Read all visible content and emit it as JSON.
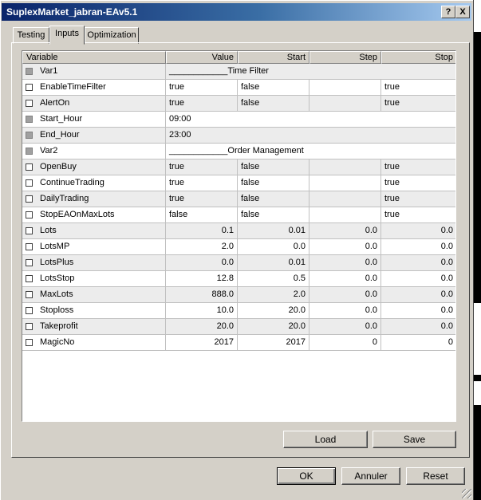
{
  "window": {
    "title": "SuplexMarket_jabran-EAv5.1",
    "help_label": "?",
    "close_label": "X"
  },
  "tabs": [
    {
      "label": "Testing",
      "active": false
    },
    {
      "label": "Inputs",
      "active": true
    },
    {
      "label": "Optimization",
      "active": false
    }
  ],
  "table": {
    "headers": [
      "Variable",
      "Value",
      "Start",
      "Step",
      "Stop"
    ],
    "rows": [
      {
        "name": "Var1",
        "value": "____________Time Filter",
        "start": "",
        "step": "",
        "stop": "",
        "checkbox": "disabled",
        "kind": "separator"
      },
      {
        "name": "EnableTimeFilter",
        "value": "true",
        "start": "false",
        "step": "",
        "stop": "true",
        "checkbox": "unchecked",
        "kind": "bool"
      },
      {
        "name": "AlertOn",
        "value": "true",
        "start": "false",
        "step": "",
        "stop": "true",
        "checkbox": "unchecked",
        "kind": "bool"
      },
      {
        "name": "Start_Hour",
        "value": "09:00",
        "start": "",
        "step": "",
        "stop": "",
        "checkbox": "disabled",
        "kind": "text"
      },
      {
        "name": "End_Hour",
        "value": "23:00",
        "start": "",
        "step": "",
        "stop": "",
        "checkbox": "disabled",
        "kind": "text"
      },
      {
        "name": "Var2",
        "value": "____________Order Management",
        "start": "",
        "step": "",
        "stop": "",
        "checkbox": "disabled",
        "kind": "separator"
      },
      {
        "name": "OpenBuy",
        "value": "true",
        "start": "false",
        "step": "",
        "stop": "true",
        "checkbox": "unchecked",
        "kind": "bool"
      },
      {
        "name": "ContinueTrading",
        "value": "true",
        "start": "false",
        "step": "",
        "stop": "true",
        "checkbox": "unchecked",
        "kind": "bool"
      },
      {
        "name": "DailyTrading",
        "value": "true",
        "start": "false",
        "step": "",
        "stop": "true",
        "checkbox": "unchecked",
        "kind": "bool"
      },
      {
        "name": "StopEAOnMaxLots",
        "value": "false",
        "start": "false",
        "step": "",
        "stop": "true",
        "checkbox": "unchecked",
        "kind": "bool"
      },
      {
        "name": "Lots",
        "value": "0.1",
        "start": "0.01",
        "step": "0.0",
        "stop": "0.0",
        "checkbox": "unchecked",
        "kind": "num"
      },
      {
        "name": "LotsMP",
        "value": "2.0",
        "start": "0.0",
        "step": "0.0",
        "stop": "0.0",
        "checkbox": "unchecked",
        "kind": "num"
      },
      {
        "name": "LotsPlus",
        "value": "0.0",
        "start": "0.01",
        "step": "0.0",
        "stop": "0.0",
        "checkbox": "unchecked",
        "kind": "num"
      },
      {
        "name": "LotsStop",
        "value": "12.8",
        "start": "0.5",
        "step": "0.0",
        "stop": "0.0",
        "checkbox": "unchecked",
        "kind": "num"
      },
      {
        "name": "MaxLots",
        "value": "888.0",
        "start": "2.0",
        "step": "0.0",
        "stop": "0.0",
        "checkbox": "unchecked",
        "kind": "num"
      },
      {
        "name": "Stoploss",
        "value": "10.0",
        "start": "20.0",
        "step": "0.0",
        "stop": "0.0",
        "checkbox": "unchecked",
        "kind": "num"
      },
      {
        "name": "Takeprofit",
        "value": "20.0",
        "start": "20.0",
        "step": "0.0",
        "stop": "0.0",
        "checkbox": "unchecked",
        "kind": "num"
      },
      {
        "name": "MagicNo",
        "value": "2017",
        "start": "2017",
        "step": "0",
        "stop": "0",
        "checkbox": "unchecked",
        "kind": "num"
      }
    ]
  },
  "buttons": {
    "load": "Load",
    "save": "Save",
    "ok": "OK",
    "cancel": "Annuler",
    "reset": "Reset"
  }
}
